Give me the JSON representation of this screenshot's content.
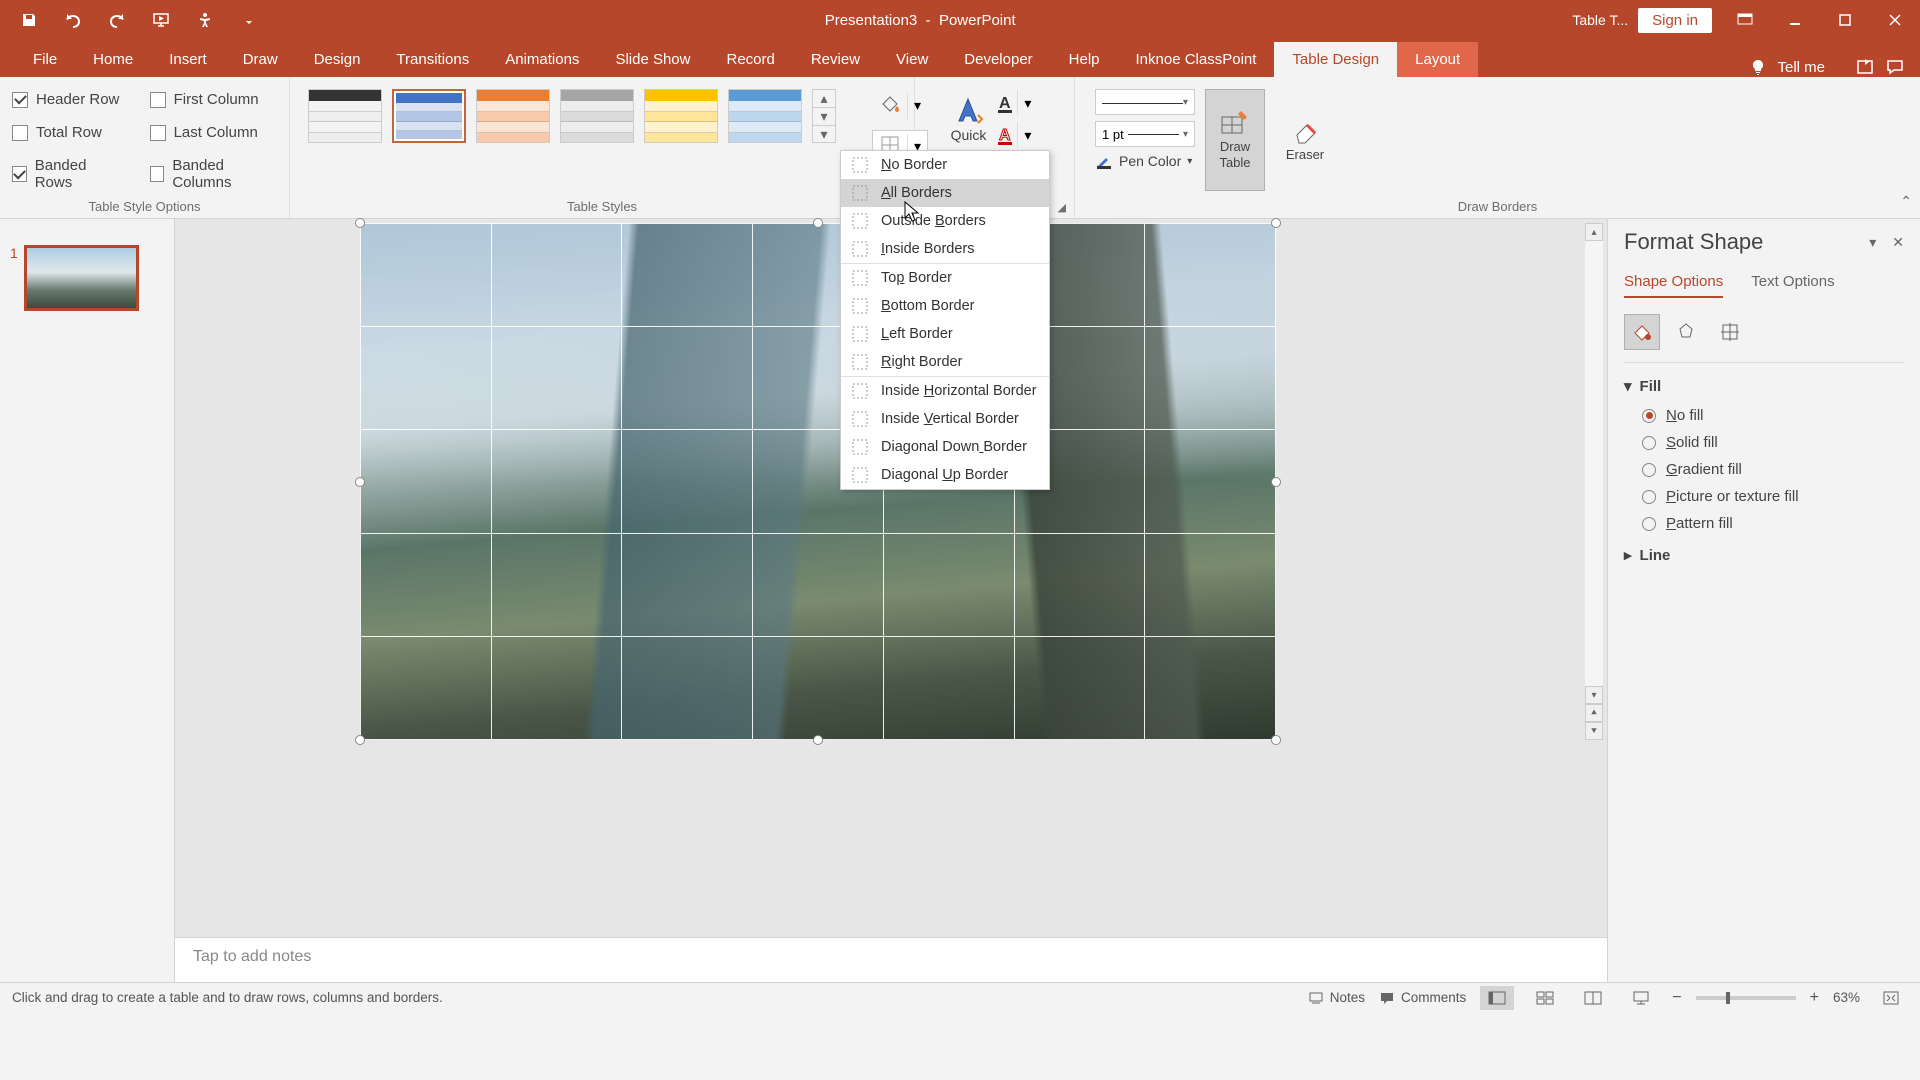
{
  "title": {
    "doc": "Presentation3",
    "app": "PowerPoint",
    "context_tab": "Table T...",
    "sign_in": "Sign in"
  },
  "ribbon_tabs": [
    "File",
    "Home",
    "Insert",
    "Draw",
    "Design",
    "Transitions",
    "Animations",
    "Slide Show",
    "Record",
    "Review",
    "View",
    "Developer",
    "Help",
    "Inknoe ClassPoint",
    "Table Design",
    "Layout"
  ],
  "active_tab": "Table Design",
  "tellme": "Tell me",
  "table_style_options": {
    "header_row": {
      "label": "Header Row",
      "checked": true
    },
    "total_row": {
      "label": "Total Row",
      "checked": false
    },
    "banded_rows": {
      "label": "Banded Rows",
      "checked": true
    },
    "first_column": {
      "label": "First Column",
      "checked": false
    },
    "last_column": {
      "label": "Last Column",
      "checked": false
    },
    "banded_columns": {
      "label": "Banded Columns",
      "checked": false
    },
    "group_label": "Table Style Options"
  },
  "table_styles": {
    "group_label": "Table Styles"
  },
  "quick_styles": {
    "label": "Quick"
  },
  "draw_borders": {
    "pen_weight": "1 pt",
    "pen_color": "Pen Color",
    "draw_table": "Draw\nTable",
    "eraser": "Eraser",
    "group_label": "Draw Borders"
  },
  "borders_menu": [
    {
      "label": "No Border",
      "u": 0
    },
    {
      "label": "All Borders",
      "u": 0,
      "hover": true
    },
    {
      "label": "Outside Borders",
      "u": 8
    },
    {
      "label": "Inside Borders",
      "u": 0
    },
    {
      "sep": true
    },
    {
      "label": "Top Border",
      "u": 2
    },
    {
      "label": "Bottom Border",
      "u": 0
    },
    {
      "label": "Left Border",
      "u": 0
    },
    {
      "label": "Right Border",
      "u": 0
    },
    {
      "sep": true
    },
    {
      "label": "Inside Horizontal Border",
      "u": 7
    },
    {
      "label": "Inside Vertical Border",
      "u": 7
    },
    {
      "label": "Diagonal Down Border",
      "u": 13
    },
    {
      "label": "Diagonal Up Border",
      "u": 9
    }
  ],
  "thumbnail": {
    "num": "1"
  },
  "notes_placeholder": "Tap to add notes",
  "format_pane": {
    "title": "Format Shape",
    "tabs": [
      "Shape Options",
      "Text Options"
    ],
    "fill": {
      "header": "Fill",
      "options": [
        "No fill",
        "Solid fill",
        "Gradient fill",
        "Picture or texture fill",
        "Pattern fill"
      ],
      "selected": "No fill",
      "underline_idx": [
        0,
        0,
        0,
        0,
        0
      ]
    },
    "line": {
      "header": "Line"
    }
  },
  "status": {
    "message": "Click and drag to create a table and to draw rows, columns and borders.",
    "notes": "Notes",
    "comments": "Comments",
    "zoom": "63%"
  }
}
